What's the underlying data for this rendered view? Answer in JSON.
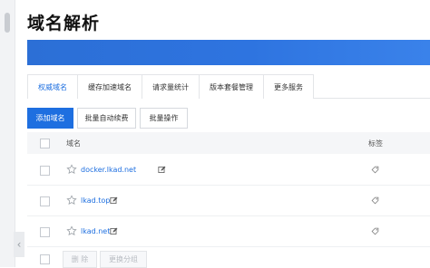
{
  "page": {
    "title": "域名解析"
  },
  "tabs": [
    {
      "label": "权威域名",
      "active": true
    },
    {
      "label": "缓存加速域名"
    },
    {
      "label": "请求量统计"
    },
    {
      "label": "版本套餐管理"
    },
    {
      "label": "更多服务"
    }
  ],
  "actions": {
    "add": "添加域名",
    "renew": "批量自动续费",
    "batch": "批量操作"
  },
  "table": {
    "header": {
      "domain": "域名",
      "tag": "标签"
    },
    "rows": [
      {
        "domain": "docker.lkad.net"
      },
      {
        "domain": "lkad.top"
      },
      {
        "domain": "lkad.net"
      }
    ]
  },
  "bottom": {
    "delete": "删 除",
    "change_group": "更换分组"
  },
  "colors": {
    "accent": "#1e6fe0",
    "banner": "#2e74e0"
  }
}
